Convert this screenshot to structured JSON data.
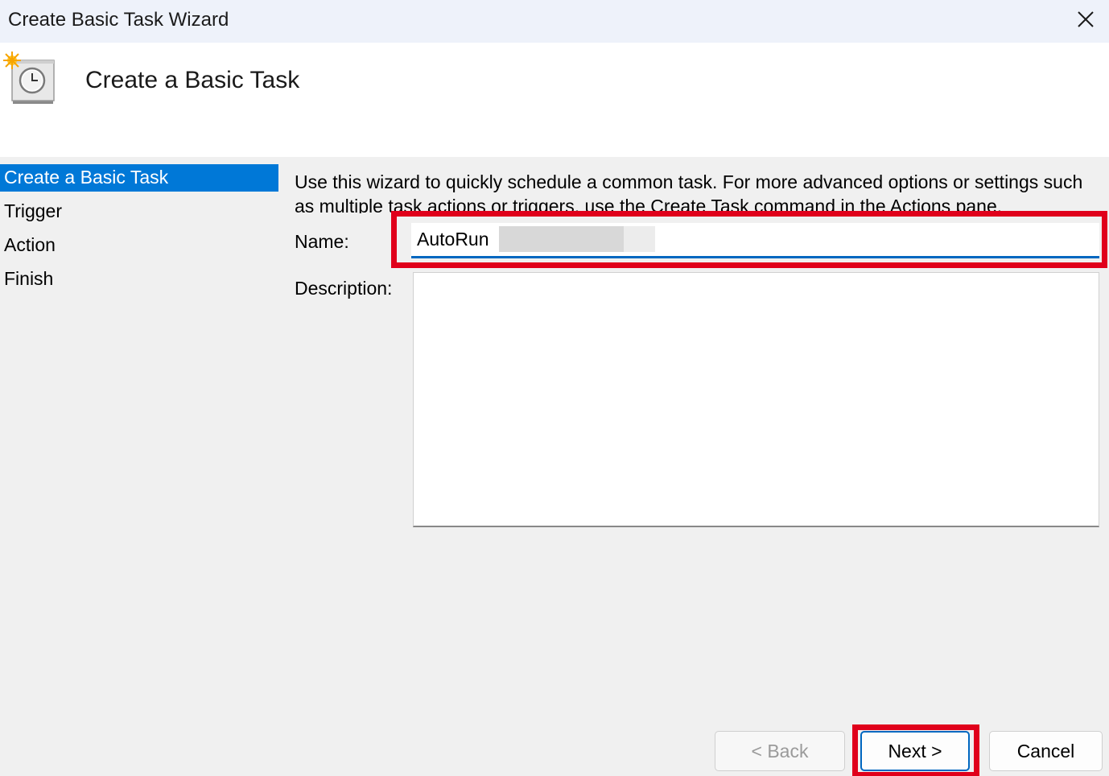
{
  "window": {
    "title": "Create Basic Task Wizard"
  },
  "header": {
    "title": "Create a Basic Task",
    "icon": "task-scheduler-clock-icon"
  },
  "steps": [
    {
      "label": "Create a Basic Task",
      "active": true
    },
    {
      "label": "Trigger",
      "active": false
    },
    {
      "label": "Action",
      "active": false
    },
    {
      "label": "Finish",
      "active": false
    }
  ],
  "main": {
    "intro_text": "Use this wizard to quickly schedule a common task.  For more advanced options or settings such as multiple task actions or triggers, use the Create Task command in the Actions pane.",
    "name_label": "Name:",
    "name_value": "AutoRun",
    "description_label": "Description:",
    "description_value": ""
  },
  "buttons": {
    "back_label": "< Back",
    "next_label": "Next >",
    "cancel_label": "Cancel"
  },
  "colors": {
    "accent": "#0078d7",
    "highlight": "#e0001b"
  }
}
